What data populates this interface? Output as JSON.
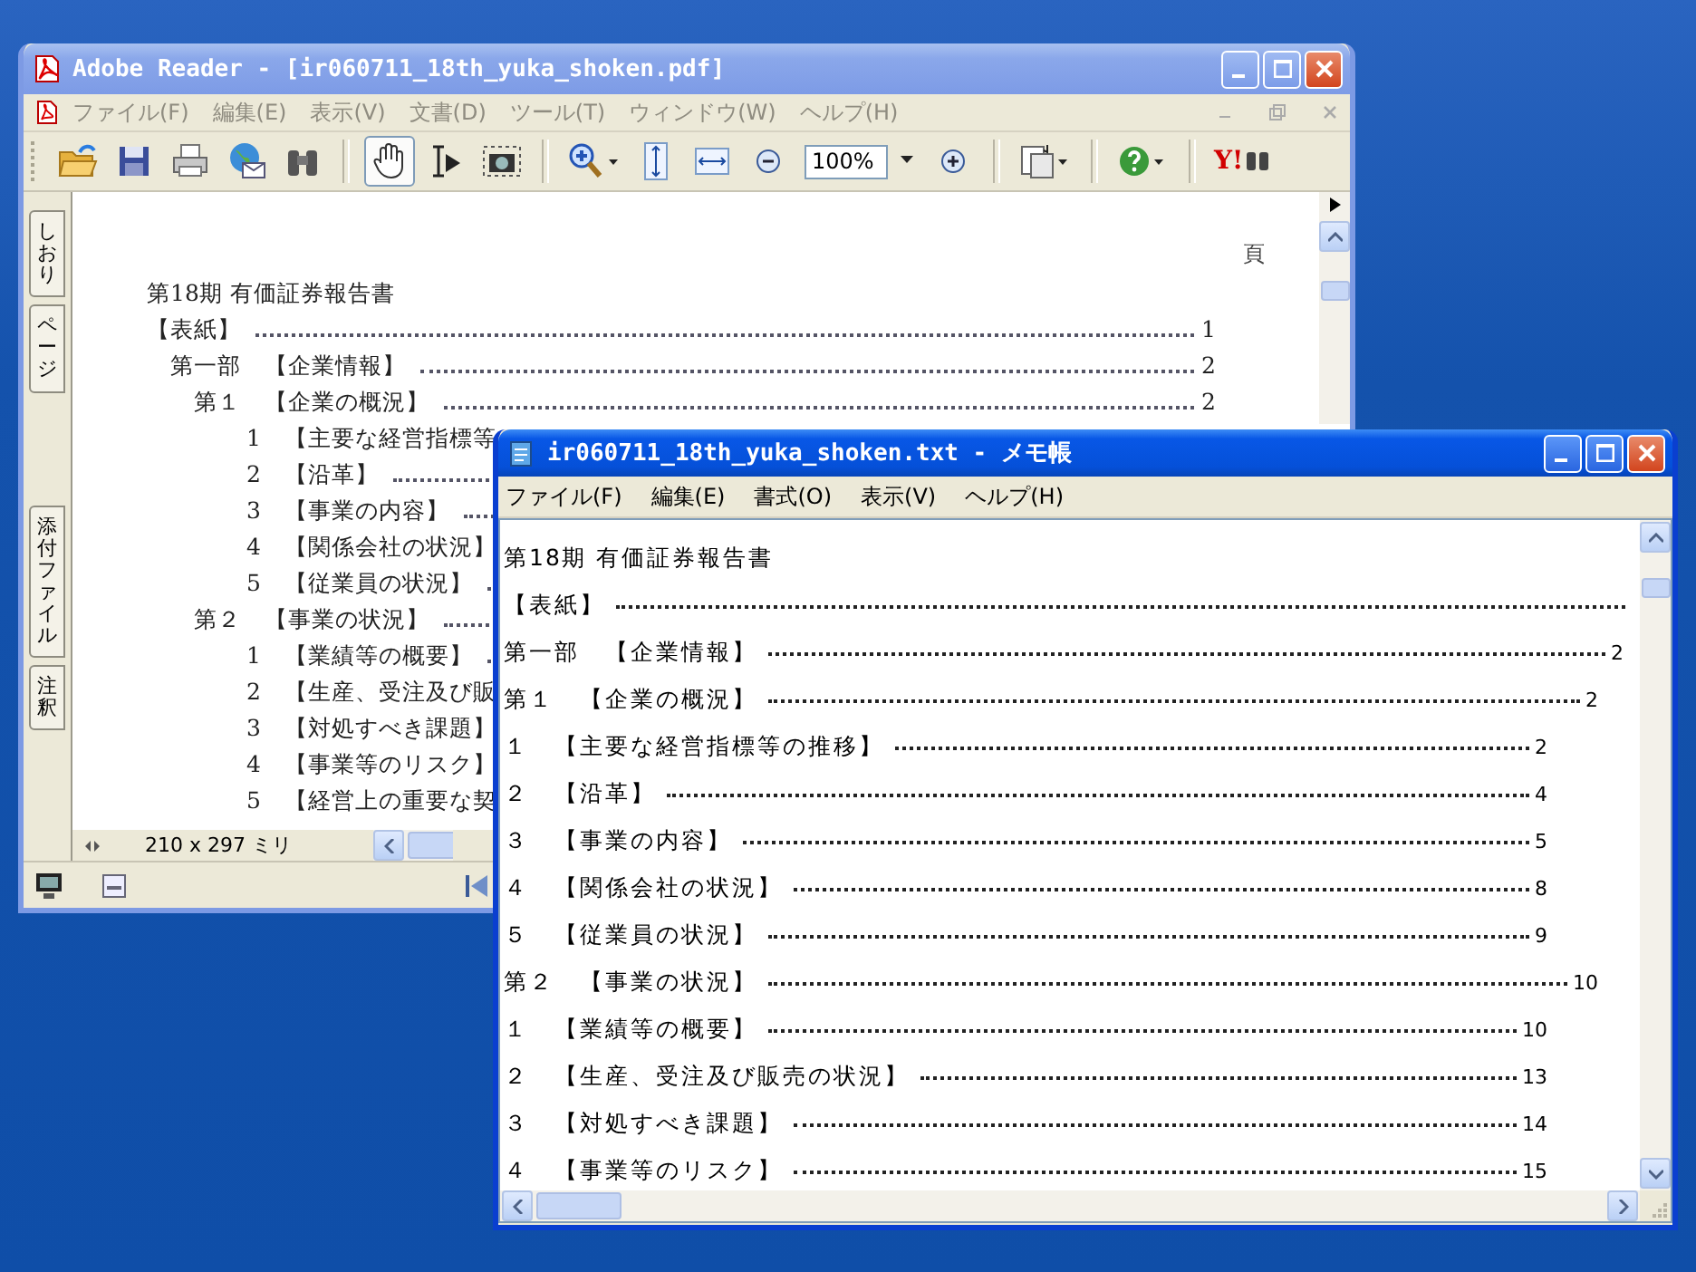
{
  "pdf_window": {
    "title": "Adobe Reader - [ir060711_18th_yuka_shoken.pdf]",
    "active": false,
    "menu": [
      {
        "label": "ファイル(F)",
        "disabled": true
      },
      {
        "label": "編集(E)",
        "disabled": true
      },
      {
        "label": "表示(V)",
        "disabled": true
      },
      {
        "label": "文書(D)",
        "disabled": true
      },
      {
        "label": "ツール(T)",
        "disabled": true
      },
      {
        "label": "ウィンドウ(W)",
        "disabled": true
      },
      {
        "label": "ヘルプ(H)",
        "disabled": true
      }
    ],
    "tools": [
      {
        "selected": true
      },
      {
        "selected": false
      },
      {
        "selected": false
      }
    ],
    "zoom": "100%",
    "logo": "Y!",
    "side_tabs": [
      "しおり",
      "ページ",
      "添付ファイル",
      "注釈"
    ],
    "page_header": "頁",
    "doc_title": "第18期 有価証券報告書",
    "toc": [
      {
        "kind": "cover",
        "label": "【表紙】",
        "page": "1"
      },
      {
        "kind": "part",
        "label": "第一部　【企業情報】",
        "page": "2"
      },
      {
        "kind": "chapter",
        "label": "第１　【企業の概況】",
        "page": "2"
      },
      {
        "kind": "item",
        "label": "1　【主要な経営指標等"
      },
      {
        "kind": "item",
        "label": "2　【沿革】"
      },
      {
        "kind": "item",
        "label": "3　【事業の内容】"
      },
      {
        "kind": "item",
        "label": "4　【関係会社の状況】"
      },
      {
        "kind": "item",
        "label": "5　【従業員の状況】"
      },
      {
        "kind": "chapter",
        "label": "第２　【事業の状況】"
      },
      {
        "kind": "item",
        "label": "1　【業績等の概要】"
      },
      {
        "kind": "item",
        "label": "2　【生産、受注及び販"
      },
      {
        "kind": "item",
        "label": "3　【対処すべき課題】"
      },
      {
        "kind": "item",
        "label": "4　【事業等のリスク】"
      },
      {
        "kind": "item",
        "label": "5　【経営上の重要な契"
      }
    ],
    "page_size": "210 x 297 ミリ"
  },
  "notepad_window": {
    "title": "ir060711_18th_yuka_shoken.txt - メモ帳",
    "active": true,
    "menu": [
      "ファイル(F)",
      "編集(E)",
      "書式(O)",
      "表示(V)",
      "ヘルプ(H)"
    ],
    "doc_title": "第18期 有価証券報告書",
    "toc": [
      {
        "kind": "cover",
        "label": "【表紙】"
      },
      {
        "kind": "part",
        "label": "第一部　【企業情報】",
        "page": "2"
      },
      {
        "kind": "chapter",
        "label": "第１　【企業の概況】",
        "page": "2"
      },
      {
        "kind": "item",
        "label": "１　【主要な経営指標等の推移】",
        "page": "2"
      },
      {
        "kind": "item",
        "label": "２　【沿革】",
        "page": "4"
      },
      {
        "kind": "item",
        "label": "３　【事業の内容】",
        "page": "5"
      },
      {
        "kind": "item",
        "label": "４　【関係会社の状況】",
        "page": "8"
      },
      {
        "kind": "item",
        "label": "５　【従業員の状況】",
        "page": "9"
      },
      {
        "kind": "chapter",
        "label": "第２　【事業の状況】",
        "page": "10"
      },
      {
        "kind": "item",
        "label": "１　【業績等の概要】",
        "page": "10"
      },
      {
        "kind": "item",
        "label": "２　【生産、受注及び販売の状況】",
        "page": "13"
      },
      {
        "kind": "item",
        "label": "３　【対処すべき課題】",
        "page": "14"
      },
      {
        "kind": "item",
        "label": "４　【事業等のリスク】",
        "page": "15"
      }
    ]
  }
}
